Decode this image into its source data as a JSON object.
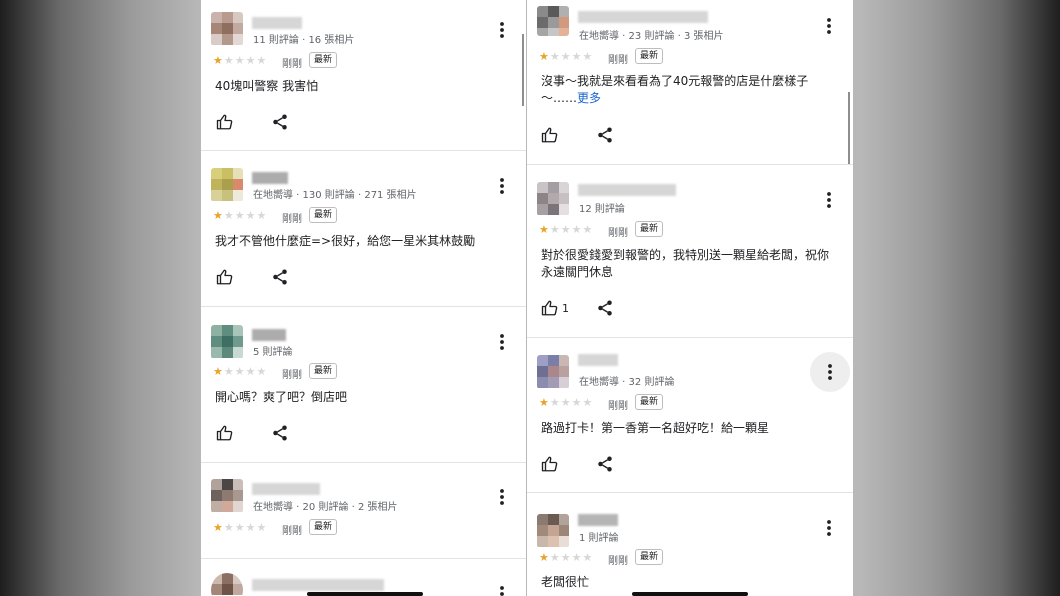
{
  "common": {
    "time_label": "剛剛",
    "badge_label": "最新"
  },
  "left_reviews": [
    {
      "meta": "11 則評論 · 16 張相片",
      "text": "40塊叫警察 我害怕",
      "like_count": "",
      "stars": 1
    },
    {
      "meta": "在地嚮導 · 130 則評論 · 271 張相片",
      "text": "我才不管他什麼症=>很好，給您一星米其林鼓勵",
      "like_count": "",
      "stars": 1
    },
    {
      "meta": "5 則評論",
      "text": "開心嗎？爽了吧？倒店吧",
      "like_count": "",
      "stars": 1
    },
    {
      "meta": "在地嚮導 · 20 則評論 · 2 張相片",
      "text": "",
      "like_count": "",
      "stars": 1
    }
  ],
  "right_reviews": [
    {
      "meta": "在地嚮導 · 23 則評論 · 3 張相片",
      "text": "沒事～我就是來看看為了40元報警的店是什麼樣子～……",
      "more": "更多",
      "like_count": "",
      "stars": 1
    },
    {
      "meta": "12 則評論",
      "text": "對於很愛錢愛到報警的，我特別送一顆星給老闆，祝你永遠關門休息",
      "like_count": "1",
      "stars": 1
    },
    {
      "meta": "在地嚮導 · 32 則評論",
      "text": "路過打卡！第一香第一名超好吃！給一顆星",
      "like_count": "",
      "stars": 1
    },
    {
      "meta": "1 則評論",
      "text": "老闆很忙",
      "like_count": "",
      "stars": 1
    }
  ],
  "colors": {
    "star_on": "#e9a32a",
    "star_off": "#d7d7d7",
    "link": "#1a66d2"
  },
  "icons": {
    "like": "thumb-up-icon",
    "share": "share-icon",
    "menu": "more-vert-icon"
  }
}
